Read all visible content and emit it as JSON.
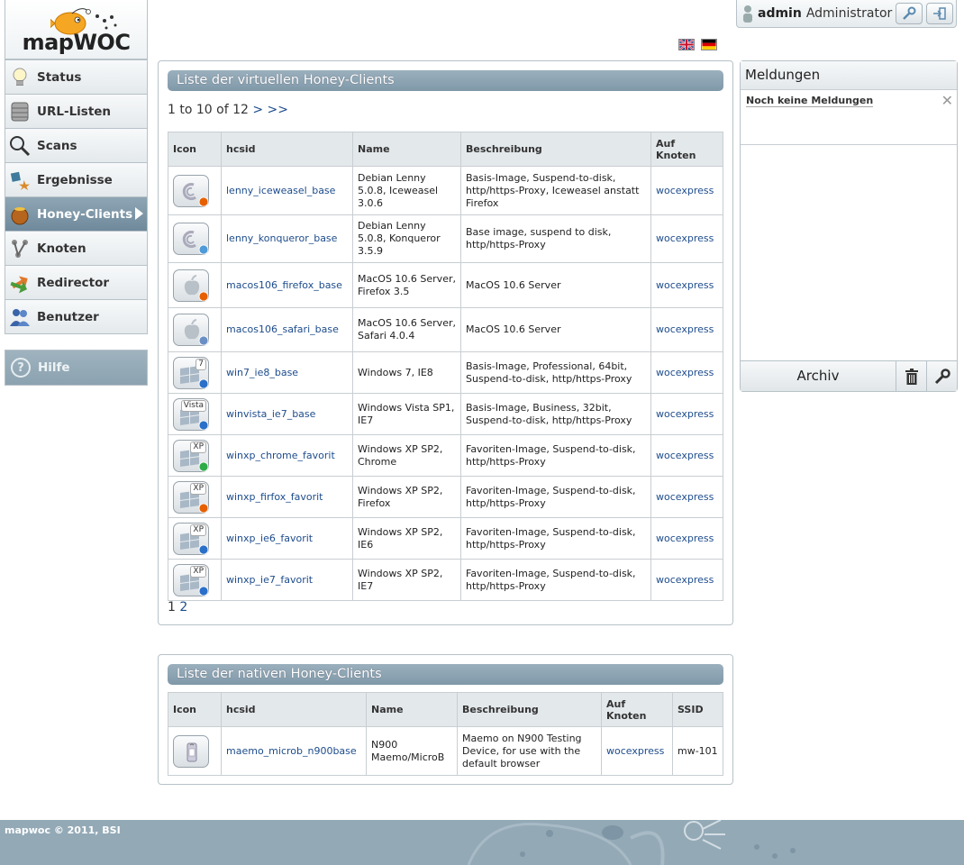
{
  "logo": {
    "brand": "mapWOC"
  },
  "nav": {
    "items": [
      {
        "label": "Status",
        "icon": "lightbulb-icon"
      },
      {
        "label": "URL-Listen",
        "icon": "database-icon"
      },
      {
        "label": "Scans",
        "icon": "magnifier-icon"
      },
      {
        "label": "Ergebnisse",
        "icon": "results-icon"
      },
      {
        "label": "Honey-Clients",
        "icon": "honeypot-icon",
        "active": true
      },
      {
        "label": "Knoten",
        "icon": "node-icon"
      },
      {
        "label": "Redirector",
        "icon": "redirect-arrows-icon"
      },
      {
        "label": "Benutzer",
        "icon": "users-icon"
      }
    ],
    "help": "Hilfe"
  },
  "userbar": {
    "username": "admin",
    "role": "Administrator"
  },
  "virtual": {
    "title": "Liste der virtuellen Honey-Clients",
    "range": "1 to 10 of 12",
    "next": ">",
    "last": ">>",
    "columns": [
      "Icon",
      "hcsid",
      "Name",
      "Beschreibung",
      "Auf Knoten"
    ],
    "rows": [
      {
        "os": "debian",
        "browser": "firefox",
        "hcsid": "lenny_iceweasel_base",
        "name": "Debian Lenny 5.0.8, Iceweasel 3.0.6",
        "desc": "Basis-Image, Suspend-to-disk, http/https-Proxy, Iceweasel anstatt Firefox",
        "node": "wocexpress"
      },
      {
        "os": "debian",
        "browser": "konqueror",
        "hcsid": "lenny_konqueror_base",
        "name": "Debian Lenny 5.0.8, Konqueror 3.5.9",
        "desc": "Base image, suspend to disk, http/https-Proxy",
        "node": "wocexpress"
      },
      {
        "os": "apple",
        "browser": "firefox",
        "hcsid": "macos106_firefox_base",
        "name": "MacOS 10.6 Server, Firefox 3.5",
        "desc": "MacOS 10.6 Server",
        "node": "wocexpress"
      },
      {
        "os": "apple",
        "browser": "safari",
        "hcsid": "macos106_safari_base",
        "name": "MacOS 10.6 Server, Safari 4.0.4",
        "desc": "MacOS 10.6 Server",
        "node": "wocexpress"
      },
      {
        "os": "windows",
        "badge": "7",
        "browser": "ie",
        "hcsid": "win7_ie8_base",
        "name": "Windows 7, IE8",
        "desc": "Basis-Image, Professional, 64bit, Suspend-to-disk, http/https-Proxy",
        "node": "wocexpress"
      },
      {
        "os": "windows",
        "badge": "Vista",
        "browser": "ie",
        "hcsid": "winvista_ie7_base",
        "name": "Windows Vista SP1, IE7",
        "desc": "Basis-Image, Business, 32bit, Suspend-to-disk, http/https-Proxy",
        "node": "wocexpress"
      },
      {
        "os": "windows",
        "badge": "XP",
        "browser": "chrome",
        "hcsid": "winxp_chrome_favorit",
        "name": "Windows XP SP2, Chrome",
        "desc": "Favoriten-Image, Suspend-to-disk, http/https-Proxy",
        "node": "wocexpress"
      },
      {
        "os": "windows",
        "badge": "XP",
        "browser": "firefox",
        "hcsid": "winxp_firfox_favorit",
        "name": "Windows XP SP2, Firefox",
        "desc": "Favoriten-Image, Suspend-to-disk, http/https-Proxy",
        "node": "wocexpress"
      },
      {
        "os": "windows",
        "badge": "XP",
        "browser": "ie",
        "hcsid": "winxp_ie6_favorit",
        "name": "Windows XP SP2, IE6",
        "desc": "Favoriten-Image, Suspend-to-disk, http/https-Proxy",
        "node": "wocexpress"
      },
      {
        "os": "windows",
        "badge": "XP",
        "browser": "ie",
        "hcsid": "winxp_ie7_favorit",
        "name": "Windows XP SP2, IE7",
        "desc": "Favoriten-Image, Suspend-to-disk, http/https-Proxy",
        "node": "wocexpress"
      }
    ],
    "pages": [
      "1",
      "2"
    ]
  },
  "native": {
    "title": "Liste der nativen Honey-Clients",
    "columns": [
      "Icon",
      "hcsid",
      "Name",
      "Beschreibung",
      "Auf Knoten",
      "SSID"
    ],
    "rows": [
      {
        "os": "mobile",
        "hcsid": "maemo_microb_n900base",
        "name": "N900 Maemo/MicroB",
        "desc": "Maemo on N900 Testing Device, for use with the default browser",
        "node": "wocexpress",
        "ssid": "mw-101"
      }
    ]
  },
  "messages": {
    "title": "Meldungen",
    "empty": "Noch keine Meldungen",
    "archive": "Archiv"
  },
  "footer": {
    "text": "mapwoc © 2011, BSI"
  },
  "colors": {
    "accent": "#7f98a8",
    "link": "#1d4c8c",
    "footer": "#93a9b6"
  }
}
